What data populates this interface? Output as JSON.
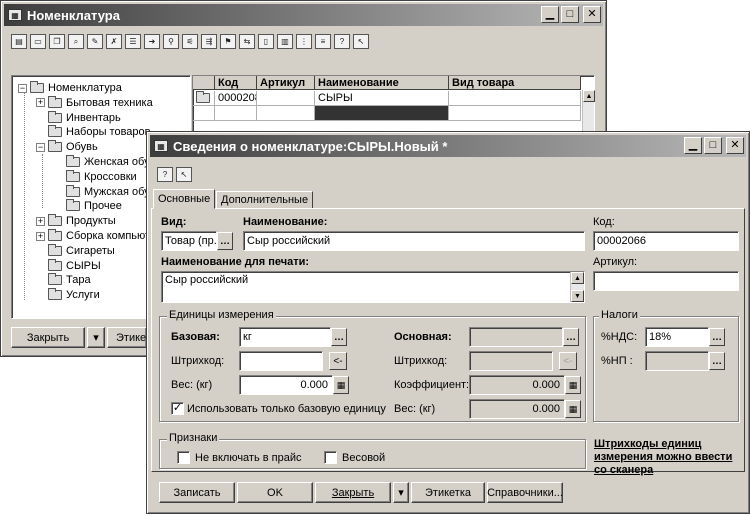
{
  "back_window": {
    "title": "Номенклатура",
    "tree": [
      {
        "label": "Номенклатура",
        "expander": "−",
        "level": 0
      },
      {
        "label": "Бытовая техника",
        "expander": "+",
        "level": 1
      },
      {
        "label": "Инвентарь",
        "expander": "",
        "level": 1
      },
      {
        "label": "Наборы товаров",
        "expander": "",
        "level": 1
      },
      {
        "label": "Обувь",
        "expander": "−",
        "level": 1
      },
      {
        "label": "Женская обу",
        "expander": "",
        "level": 2
      },
      {
        "label": "Кроссовки",
        "expander": "",
        "level": 2
      },
      {
        "label": "Мужская обу",
        "expander": "",
        "level": 2
      },
      {
        "label": "Прочее",
        "expander": "",
        "level": 2
      },
      {
        "label": "Продукты",
        "expander": "+",
        "level": 1
      },
      {
        "label": "Сборка компьют",
        "expander": "+",
        "level": 1
      },
      {
        "label": "Сигареты",
        "expander": "",
        "level": 1
      },
      {
        "label": "СЫРЫ",
        "expander": "",
        "level": 1
      },
      {
        "label": "Тара",
        "expander": "",
        "level": 1
      },
      {
        "label": "Услуги",
        "expander": "",
        "level": 1
      }
    ],
    "grid": {
      "headers": [
        "Код",
        "Артикул",
        "Наименование",
        "Вид товара"
      ],
      "row": {
        "code": "0000208",
        "article": "",
        "name": "СЫРЫ",
        "kind": ""
      }
    },
    "buttons": {
      "close": "Закрыть",
      "label": "Этике"
    }
  },
  "front_window": {
    "title": "Сведения о номенклатуре:СЫРЫ.Новый *",
    "tabs": [
      "Основные",
      "Дополнительные"
    ],
    "labels": {
      "vid": "Вид:",
      "name": "Наименование:",
      "code": "Код:",
      "print_name": "Наименование для печати:",
      "article": "Артикул:"
    },
    "values": {
      "vid": "Товар (пр.",
      "name": "Сыр российский",
      "code": "00002066",
      "print_name": "Сыр российский",
      "article": ""
    },
    "units": {
      "group_title": "Единицы измерения",
      "base_label": "Базовая:",
      "base_value": "кг",
      "main_label": "Основная:",
      "main_value": "",
      "barcode_label": "Штрихкод:",
      "barcode_value": "",
      "barcode_btn": "<-",
      "main_barcode_label": "Штрихкод:",
      "weight_label": "Вес: (кг)",
      "weight_value": "0.000",
      "coef_label": "Коэффициент:",
      "coef_value": "0.000",
      "main_weight_label": "Вес: (кг)",
      "main_weight_value": "0.000",
      "only_base_label": "Использовать только базовую единицу",
      "only_base_checked": "✓"
    },
    "taxes": {
      "group_title": "Налоги",
      "vat_label": "%НДС:",
      "vat_value": "18%",
      "np_label": "%НП :",
      "np_value": ""
    },
    "signs": {
      "group_title": "Признаки",
      "exclude_price": "Не включать в прайс",
      "weighted": "Весовой"
    },
    "barcode_link": [
      "Штрихкоды единиц",
      "измерения можно ввести",
      "со сканера"
    ],
    "buttons": {
      "save": "Записать",
      "ok": "OK",
      "close": "Закрыть",
      "label": "Этикетка",
      "refs": "Справочники..."
    }
  }
}
